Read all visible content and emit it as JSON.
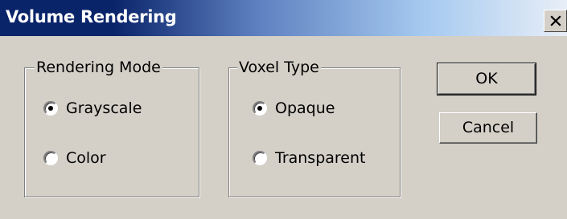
{
  "window": {
    "title": "Volume Rendering",
    "close_label": "X"
  },
  "rendering_mode": {
    "legend": "Rendering Mode",
    "options": [
      {
        "label": "Grayscale",
        "selected": true
      },
      {
        "label": "Color",
        "selected": false
      }
    ]
  },
  "voxel_type": {
    "legend": "Voxel Type",
    "options": [
      {
        "label": "Opaque",
        "selected": true
      },
      {
        "label": "Transparent",
        "selected": false
      }
    ]
  },
  "buttons": {
    "ok_label": "OK",
    "cancel_label": "Cancel"
  },
  "icons": {
    "close": "close-icon",
    "radio_selected": "radio-selected",
    "radio_unselected": "radio-unselected"
  },
  "colors": {
    "titlebar_start": "#0a246a",
    "titlebar_end": "#e8eef7",
    "dialog_bg": "#d4d0c8"
  }
}
